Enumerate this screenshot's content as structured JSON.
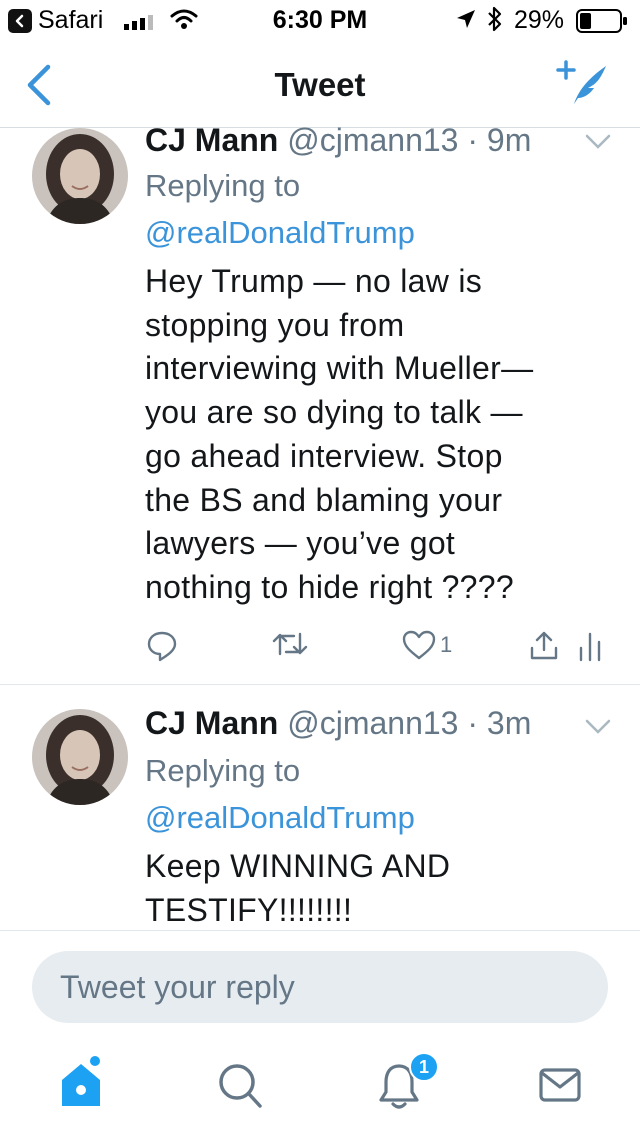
{
  "status_bar": {
    "back_app": "Safari",
    "time": "6:30 PM",
    "battery_percent": "29%",
    "battery_level": 0.29
  },
  "nav": {
    "title": "Tweet",
    "accent_color": "#3b94d9"
  },
  "tweets": [
    {
      "name": "CJ Mann",
      "handle": "@cjmann13",
      "time": "· 9m",
      "replying_label": "Replying to",
      "replying_to": "@realDonaldTrump",
      "body_lines": [
        "Hey Trump — no law is",
        "stopping you from",
        "interviewing with Mueller—",
        "you are so dying to talk —",
        "go ahead interview. Stop",
        "the BS and blaming your",
        "lawyers — you’ve got",
        "nothing to hide right ????"
      ],
      "like_count": "1"
    },
    {
      "name": "CJ Mann",
      "handle": "@cjmann13",
      "time": "· 3m",
      "replying_label": "Replying to",
      "replying_to": "@realDonaldTrump",
      "body_lines": [
        "Keep WINNING AND",
        "TESTIFY!!!!!!!!"
      ]
    }
  ],
  "reply": {
    "placeholder": "Tweet your reply"
  },
  "tab_bar": {
    "items": [
      "home-icon",
      "search-icon",
      "notifications-icon",
      "messages-icon"
    ],
    "notification_badge": "1",
    "active_color": "#1da1f2",
    "inactive_color": "#657786"
  }
}
